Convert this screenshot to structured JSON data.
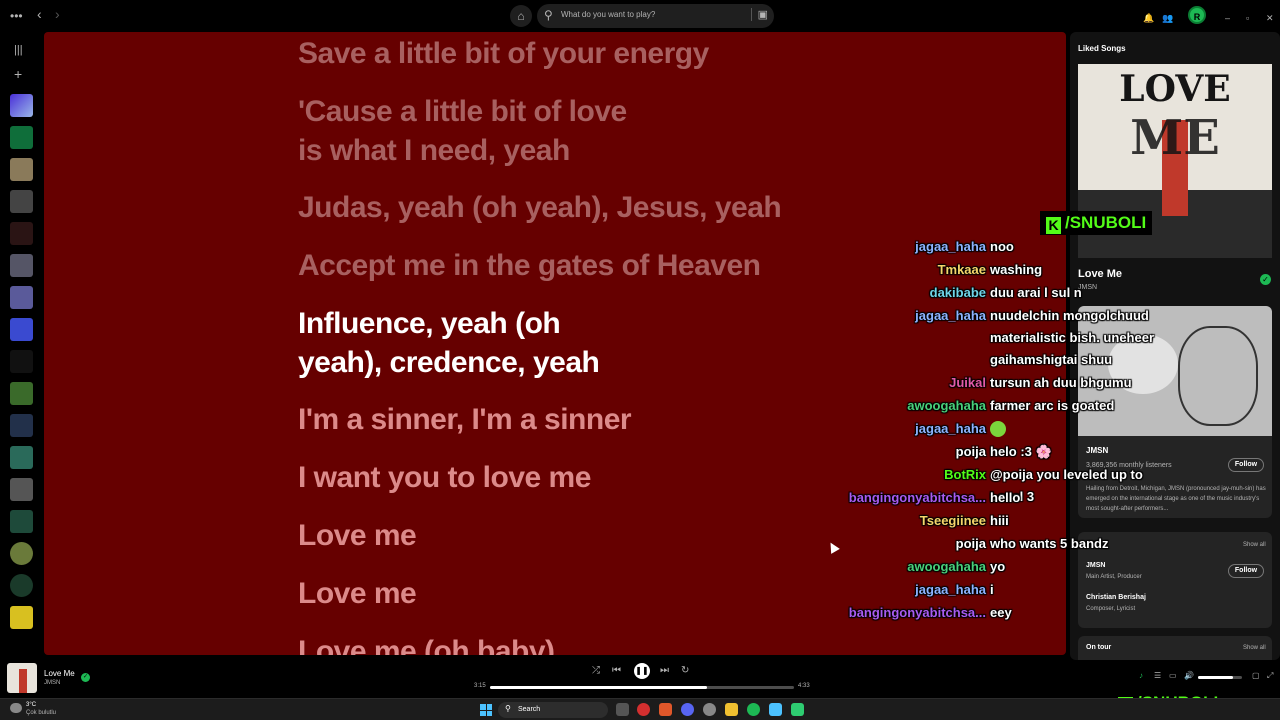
{
  "topbar": {
    "menu_icon": "•••",
    "back_icon": "‹",
    "forward_icon": "›",
    "home_icon": "⌂",
    "search_icon": "⚲",
    "search_placeholder": "What do you want to play?",
    "browse_icon": "▣",
    "bell_icon": "🔔",
    "friends_icon": "👥",
    "avatar_initial": "R",
    "minimize": "–",
    "maximize": "▫",
    "close": "✕"
  },
  "rail": {
    "library_icon": "|||",
    "add_icon": "+"
  },
  "lyrics": [
    {
      "text": "Save a little bit of your energy",
      "state": "past"
    },
    {
      "text": "'Cause a little bit of love is what I need, yeah",
      "state": "past"
    },
    {
      "text": "Judas, yeah (oh yeah), Jesus, yeah",
      "state": "past"
    },
    {
      "text": "Accept me in the gates of Heaven",
      "state": "past"
    },
    {
      "text": "Influence, yeah (oh yeah), credence, yeah",
      "state": "active"
    },
    {
      "text": "I'm a sinner, I'm a sinner",
      "state": "upcoming"
    },
    {
      "text": "I want you to love me",
      "state": "upcoming"
    },
    {
      "text": "Love me",
      "state": "upcoming"
    },
    {
      "text": "Love me",
      "state": "upcoming"
    },
    {
      "text": "Love me (oh baby)",
      "state": "upcoming"
    }
  ],
  "right_panel": {
    "title": "Liked Songs",
    "cover_word_top": "LOVE",
    "cover_word_bottom": "ME",
    "song_title": "Love Me",
    "song_artist": "JMSN",
    "liked_check": "✓",
    "artist_card": {
      "name": "JMSN",
      "listeners": "3,869,356 monthly listeners",
      "follow_label": "Follow",
      "bio": "Hailing from Detroit, Michigan, JMSN (pronounced jay-muh-sin) has emerged on the international stage as one of the music industry's most sought-after performers..."
    },
    "credits": {
      "show_all": "Show all",
      "people": [
        {
          "name": "JMSN",
          "role": "Main Artist, Producer",
          "follow": "Follow"
        },
        {
          "name": "Christian Berishaj",
          "role": "Composer, Lyricist"
        }
      ]
    },
    "on_tour": "On tour",
    "on_tour_show_all": "Show all"
  },
  "chat": [
    {
      "user": "jagaa_haha",
      "color": "#8db3ff",
      "msg": "noo"
    },
    {
      "user": "Tmkaae",
      "color": "#f5d56a",
      "msg": "washing"
    },
    {
      "user": "dakibabe",
      "color": "#6fd5e8",
      "msg": "duu arai l sul n"
    },
    {
      "user": "jagaa_haha",
      "color": "#8db3ff",
      "msg": "nuudelchin mongolchuud materialistic bish. uneheer gaihamshigtai shuu"
    },
    {
      "user": "Juikal",
      "color": "#e25aa8",
      "msg": "tursun ah duu bhgumu"
    },
    {
      "user": "awoogahaha",
      "color": "#49d07a",
      "msg": "farmer arc is goated"
    },
    {
      "user": "jagaa_haha",
      "color": "#8db3ff",
      "msg": ""
    },
    {
      "user": "poija",
      "color": "#ffffff",
      "msg": "helo :3 🌸"
    },
    {
      "user": "BotRix",
      "color": "#53fc18",
      "msg": "@poija you leveled up to Level 3"
    },
    {
      "user": "bangingonyabitchsa...",
      "color": "#a95bf0",
      "msg": "hello"
    },
    {
      "user": "Tseegiinee",
      "color": "#f5d56a",
      "msg": "hiii"
    },
    {
      "user": "poija",
      "color": "#ffffff",
      "msg": "who wants 5 bandz"
    },
    {
      "user": "awoogahaha",
      "color": "#49d07a",
      "msg": "yo"
    },
    {
      "user": "jagaa_haha",
      "color": "#8db3ff",
      "msg": "i"
    },
    {
      "user": "bangingonyabitchsa...",
      "color": "#a95bf0",
      "msg": "eey"
    }
  ],
  "watermark": {
    "k": "K",
    "text": "/SNUBOLI"
  },
  "player": {
    "title": "Love Me",
    "artist": "JMSN",
    "check": "✓",
    "shuffle": "⤮",
    "prev": "⏮",
    "pause": "❚❚",
    "next": "⏭",
    "repeat": "↻",
    "elapsed": "3:15",
    "duration": "4:33",
    "progress": 0.714,
    "volume": 0.8,
    "now_playing_icon": "♪",
    "queue_icon": "☰",
    "device_icon": "▭",
    "volume_icon": "🔊",
    "mini_icon": "▢",
    "fullscreen_icon": "⤢"
  },
  "taskbar": {
    "temp": "3°C",
    "weather": "Çok bulutlu",
    "search_label": "Search"
  }
}
